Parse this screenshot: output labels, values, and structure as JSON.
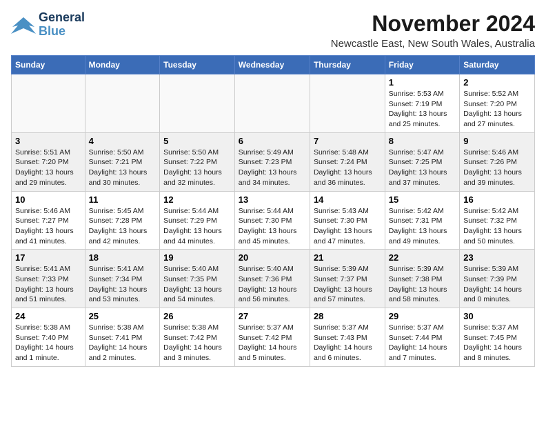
{
  "logo": {
    "line1": "General",
    "line2": "Blue"
  },
  "title": "November 2024",
  "subtitle": "Newcastle East, New South Wales, Australia",
  "days_of_week": [
    "Sunday",
    "Monday",
    "Tuesday",
    "Wednesday",
    "Thursday",
    "Friday",
    "Saturday"
  ],
  "weeks": [
    [
      {
        "day": "",
        "info": ""
      },
      {
        "day": "",
        "info": ""
      },
      {
        "day": "",
        "info": ""
      },
      {
        "day": "",
        "info": ""
      },
      {
        "day": "",
        "info": ""
      },
      {
        "day": "1",
        "info": "Sunrise: 5:53 AM\nSunset: 7:19 PM\nDaylight: 13 hours\nand 25 minutes."
      },
      {
        "day": "2",
        "info": "Sunrise: 5:52 AM\nSunset: 7:20 PM\nDaylight: 13 hours\nand 27 minutes."
      }
    ],
    [
      {
        "day": "3",
        "info": "Sunrise: 5:51 AM\nSunset: 7:20 PM\nDaylight: 13 hours\nand 29 minutes."
      },
      {
        "day": "4",
        "info": "Sunrise: 5:50 AM\nSunset: 7:21 PM\nDaylight: 13 hours\nand 30 minutes."
      },
      {
        "day": "5",
        "info": "Sunrise: 5:50 AM\nSunset: 7:22 PM\nDaylight: 13 hours\nand 32 minutes."
      },
      {
        "day": "6",
        "info": "Sunrise: 5:49 AM\nSunset: 7:23 PM\nDaylight: 13 hours\nand 34 minutes."
      },
      {
        "day": "7",
        "info": "Sunrise: 5:48 AM\nSunset: 7:24 PM\nDaylight: 13 hours\nand 36 minutes."
      },
      {
        "day": "8",
        "info": "Sunrise: 5:47 AM\nSunset: 7:25 PM\nDaylight: 13 hours\nand 37 minutes."
      },
      {
        "day": "9",
        "info": "Sunrise: 5:46 AM\nSunset: 7:26 PM\nDaylight: 13 hours\nand 39 minutes."
      }
    ],
    [
      {
        "day": "10",
        "info": "Sunrise: 5:46 AM\nSunset: 7:27 PM\nDaylight: 13 hours\nand 41 minutes."
      },
      {
        "day": "11",
        "info": "Sunrise: 5:45 AM\nSunset: 7:28 PM\nDaylight: 13 hours\nand 42 minutes."
      },
      {
        "day": "12",
        "info": "Sunrise: 5:44 AM\nSunset: 7:29 PM\nDaylight: 13 hours\nand 44 minutes."
      },
      {
        "day": "13",
        "info": "Sunrise: 5:44 AM\nSunset: 7:30 PM\nDaylight: 13 hours\nand 45 minutes."
      },
      {
        "day": "14",
        "info": "Sunrise: 5:43 AM\nSunset: 7:30 PM\nDaylight: 13 hours\nand 47 minutes."
      },
      {
        "day": "15",
        "info": "Sunrise: 5:42 AM\nSunset: 7:31 PM\nDaylight: 13 hours\nand 49 minutes."
      },
      {
        "day": "16",
        "info": "Sunrise: 5:42 AM\nSunset: 7:32 PM\nDaylight: 13 hours\nand 50 minutes."
      }
    ],
    [
      {
        "day": "17",
        "info": "Sunrise: 5:41 AM\nSunset: 7:33 PM\nDaylight: 13 hours\nand 51 minutes."
      },
      {
        "day": "18",
        "info": "Sunrise: 5:41 AM\nSunset: 7:34 PM\nDaylight: 13 hours\nand 53 minutes."
      },
      {
        "day": "19",
        "info": "Sunrise: 5:40 AM\nSunset: 7:35 PM\nDaylight: 13 hours\nand 54 minutes."
      },
      {
        "day": "20",
        "info": "Sunrise: 5:40 AM\nSunset: 7:36 PM\nDaylight: 13 hours\nand 56 minutes."
      },
      {
        "day": "21",
        "info": "Sunrise: 5:39 AM\nSunset: 7:37 PM\nDaylight: 13 hours\nand 57 minutes."
      },
      {
        "day": "22",
        "info": "Sunrise: 5:39 AM\nSunset: 7:38 PM\nDaylight: 13 hours\nand 58 minutes."
      },
      {
        "day": "23",
        "info": "Sunrise: 5:39 AM\nSunset: 7:39 PM\nDaylight: 14 hours\nand 0 minutes."
      }
    ],
    [
      {
        "day": "24",
        "info": "Sunrise: 5:38 AM\nSunset: 7:40 PM\nDaylight: 14 hours\nand 1 minute."
      },
      {
        "day": "25",
        "info": "Sunrise: 5:38 AM\nSunset: 7:41 PM\nDaylight: 14 hours\nand 2 minutes."
      },
      {
        "day": "26",
        "info": "Sunrise: 5:38 AM\nSunset: 7:42 PM\nDaylight: 14 hours\nand 3 minutes."
      },
      {
        "day": "27",
        "info": "Sunrise: 5:37 AM\nSunset: 7:42 PM\nDaylight: 14 hours\nand 5 minutes."
      },
      {
        "day": "28",
        "info": "Sunrise: 5:37 AM\nSunset: 7:43 PM\nDaylight: 14 hours\nand 6 minutes."
      },
      {
        "day": "29",
        "info": "Sunrise: 5:37 AM\nSunset: 7:44 PM\nDaylight: 14 hours\nand 7 minutes."
      },
      {
        "day": "30",
        "info": "Sunrise: 5:37 AM\nSunset: 7:45 PM\nDaylight: 14 hours\nand 8 minutes."
      }
    ]
  ]
}
